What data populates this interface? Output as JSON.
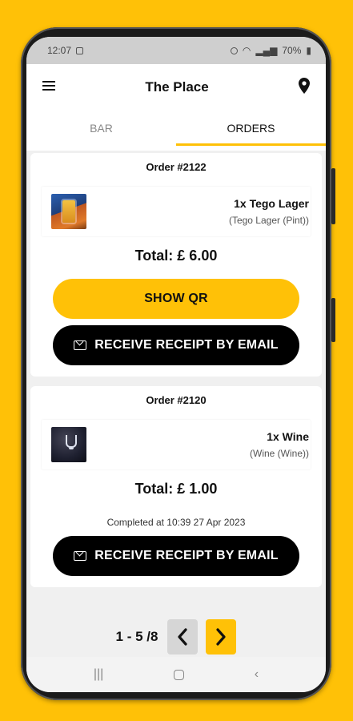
{
  "status_bar": {
    "time": "12:07",
    "battery": "70%"
  },
  "header": {
    "title": "The Place",
    "menu_icon": "hamburger-menu-icon",
    "location_icon": "map-pin-icon"
  },
  "tabs": [
    {
      "label": "BAR",
      "active": false
    },
    {
      "label": "ORDERS",
      "active": true
    }
  ],
  "orders": [
    {
      "title": "Order #2122",
      "item_name": "1x Tego Lager",
      "item_detail": "(Tego Lager (Pint))",
      "total": "Total: £ 6.00",
      "qr_label": "SHOW QR",
      "email_label": "RECEIVE RECEIPT BY EMAIL"
    },
    {
      "title": "Order #2120",
      "item_name": "1x Wine",
      "item_detail": "(Wine (Wine))",
      "total": "Total: £ 1.00",
      "completed": "Completed at 10:39 27 Apr 2023",
      "email_label": "RECEIVE RECEIPT BY EMAIL"
    }
  ],
  "pagination": {
    "label": "1 - 5 /8",
    "prev": "‹",
    "next": "›"
  },
  "colors": {
    "accent": "#FFC107",
    "dark": "#000000"
  }
}
